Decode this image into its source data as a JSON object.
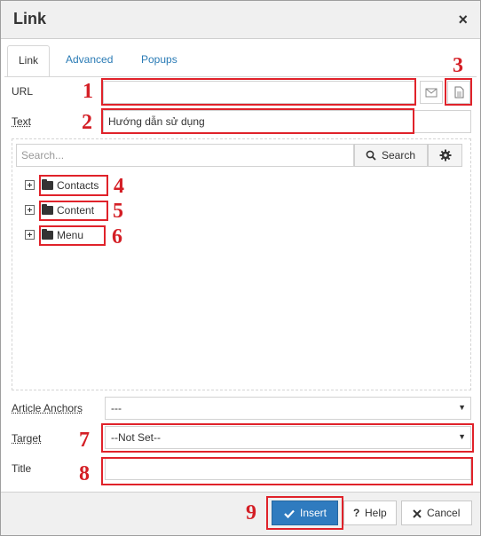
{
  "dialog": {
    "title": "Link",
    "close": "×"
  },
  "tabs": [
    {
      "label": "Link",
      "active": true
    },
    {
      "label": "Advanced",
      "active": false
    },
    {
      "label": "Popups",
      "active": false
    }
  ],
  "fields": {
    "url_label": "URL",
    "url_value": "",
    "text_label": "Text",
    "text_value": "Hướng dẫn sử dụng",
    "anchors_label": "Article Anchors",
    "anchors_value": "---",
    "target_label": "Target",
    "target_value": "--Not Set--",
    "title_label": "Title",
    "title_value": ""
  },
  "browser": {
    "search_placeholder": "Search...",
    "search_button": "Search",
    "items": [
      {
        "label": "Contacts"
      },
      {
        "label": "Content"
      },
      {
        "label": "Menu"
      }
    ]
  },
  "footer": {
    "insert": "Insert",
    "help": "Help",
    "cancel": "Cancel"
  },
  "annotations": [
    "1",
    "2",
    "3",
    "4",
    "5",
    "6",
    "7",
    "8",
    "9"
  ],
  "colors": {
    "annotation": "#e0222a",
    "primary_button": "#2f7bbf",
    "link": "#2a7bb5"
  },
  "icons": [
    "close-icon",
    "email-icon",
    "file-icon",
    "search-icon",
    "gear-icon",
    "expand-plus-icon",
    "folder-icon",
    "check-icon",
    "question-icon",
    "x-icon",
    "dropdown-arrow-icon"
  ]
}
